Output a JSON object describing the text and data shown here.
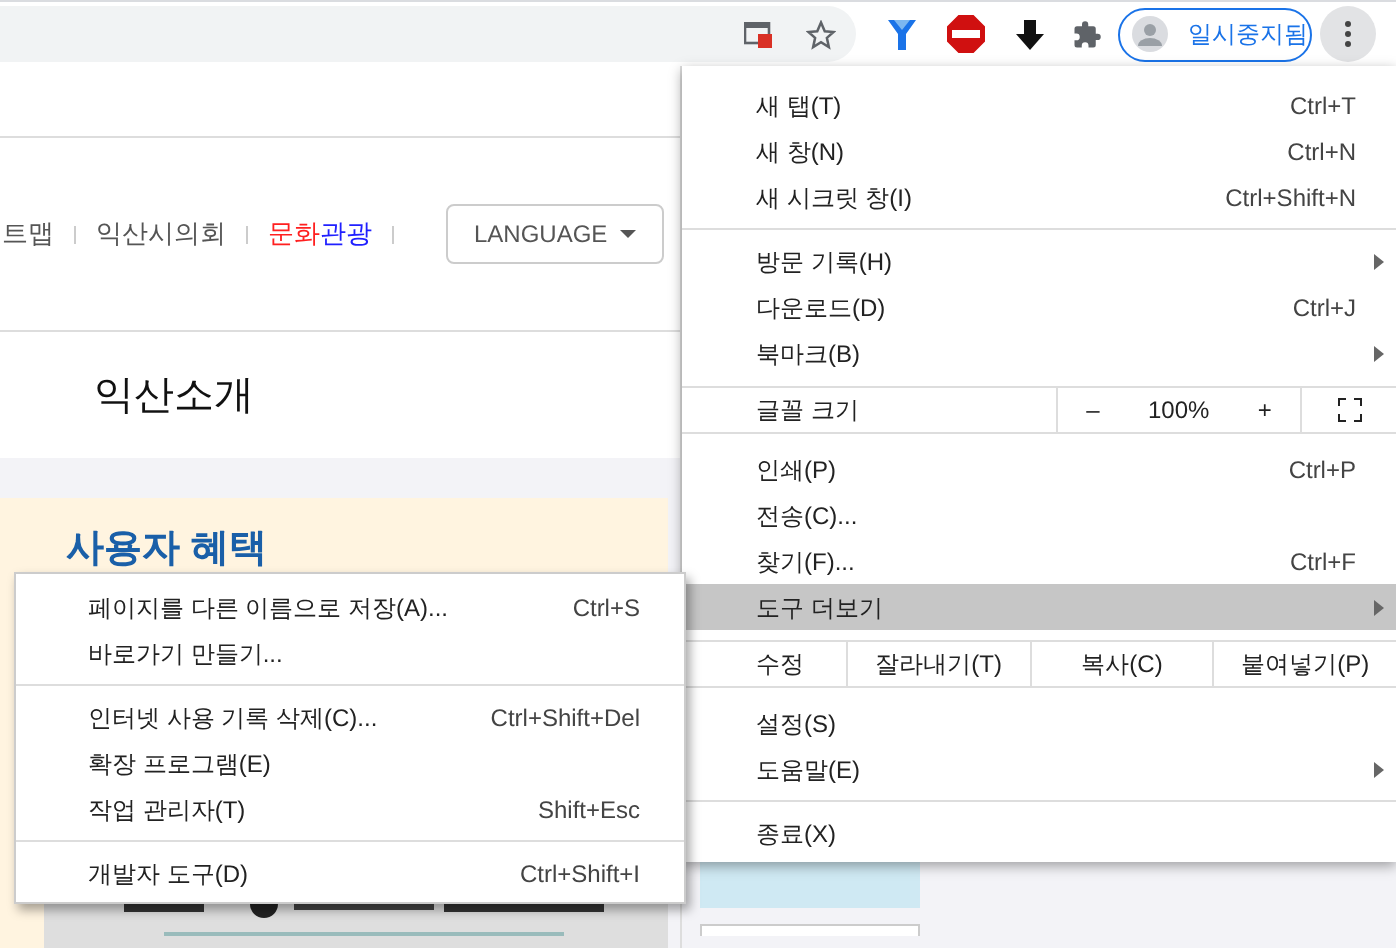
{
  "toolbar": {
    "profile": {
      "label": "일시중지됨"
    }
  },
  "page": {
    "nav": [
      {
        "parts": [
          {
            "text": "트맵",
            "color": "#555555"
          }
        ]
      },
      {
        "parts": [
          {
            "text": "익산시의회",
            "color": "#555555"
          }
        ]
      },
      {
        "parts": [
          {
            "text": "문화",
            "color": "#ff2020"
          },
          {
            "text": "관광",
            "color": "#2020ff"
          }
        ]
      }
    ],
    "language": {
      "label": "LANGUAGE"
    },
    "title": "익산소개",
    "benefit_title": "사용자 혜택"
  },
  "menu": {
    "items": [
      {
        "kind": "item",
        "label": "새 탭(T)",
        "shortcut": "Ctrl+T",
        "submenu": false,
        "selected": false
      },
      {
        "kind": "item",
        "label": "새 창(N)",
        "shortcut": "Ctrl+N",
        "submenu": false,
        "selected": false
      },
      {
        "kind": "item",
        "label": "새 시크릿 창(I)",
        "shortcut": "Ctrl+Shift+N",
        "submenu": false,
        "selected": false
      },
      {
        "kind": "separator"
      },
      {
        "kind": "item",
        "label": "방문 기록(H)",
        "submenu": true,
        "selected": false
      },
      {
        "kind": "item",
        "label": "다운로드(D)",
        "shortcut": "Ctrl+J",
        "submenu": false,
        "selected": false
      },
      {
        "kind": "item",
        "label": "북마크(B)",
        "submenu": true,
        "selected": false
      },
      {
        "kind": "zoom",
        "label": "글꼴 크기",
        "minus": "–",
        "value": "100%",
        "plus": "+"
      },
      {
        "kind": "item",
        "label": "인쇄(P)",
        "shortcut": "Ctrl+P",
        "submenu": false,
        "selected": false
      },
      {
        "kind": "item",
        "label": "전송(C)...",
        "submenu": false,
        "selected": false
      },
      {
        "kind": "item",
        "label": "찾기(F)...",
        "shortcut": "Ctrl+F",
        "submenu": false,
        "selected": false
      },
      {
        "kind": "item",
        "label": "도구 더보기",
        "submenu": true,
        "selected": true
      },
      {
        "kind": "edit",
        "label": "수정",
        "buttons": [
          "잘라내기(T)",
          "복사(C)",
          "붙여넣기(P)"
        ]
      },
      {
        "kind": "item",
        "label": "설정(S)",
        "submenu": false,
        "selected": false
      },
      {
        "kind": "item",
        "label": "도움말(E)",
        "submenu": true,
        "selected": false
      },
      {
        "kind": "separator"
      },
      {
        "kind": "item",
        "label": "종료(X)",
        "submenu": false,
        "selected": false
      }
    ]
  },
  "submenu": {
    "items": [
      {
        "kind": "item",
        "label": "페이지를 다른 이름으로 저장(A)...",
        "shortcut": "Ctrl+S"
      },
      {
        "kind": "item",
        "label": "바로가기 만들기..."
      },
      {
        "kind": "separator"
      },
      {
        "kind": "item",
        "label": "인터넷 사용 기록 삭제(C)...",
        "shortcut": "Ctrl+Shift+Del"
      },
      {
        "kind": "item",
        "label": "확장 프로그램(E)"
      },
      {
        "kind": "item",
        "label": "작업 관리자(T)",
        "shortcut": "Shift+Esc"
      },
      {
        "kind": "separator"
      },
      {
        "kind": "item",
        "label": "개발자 도구(D)",
        "shortcut": "Ctrl+Shift+I"
      }
    ]
  }
}
